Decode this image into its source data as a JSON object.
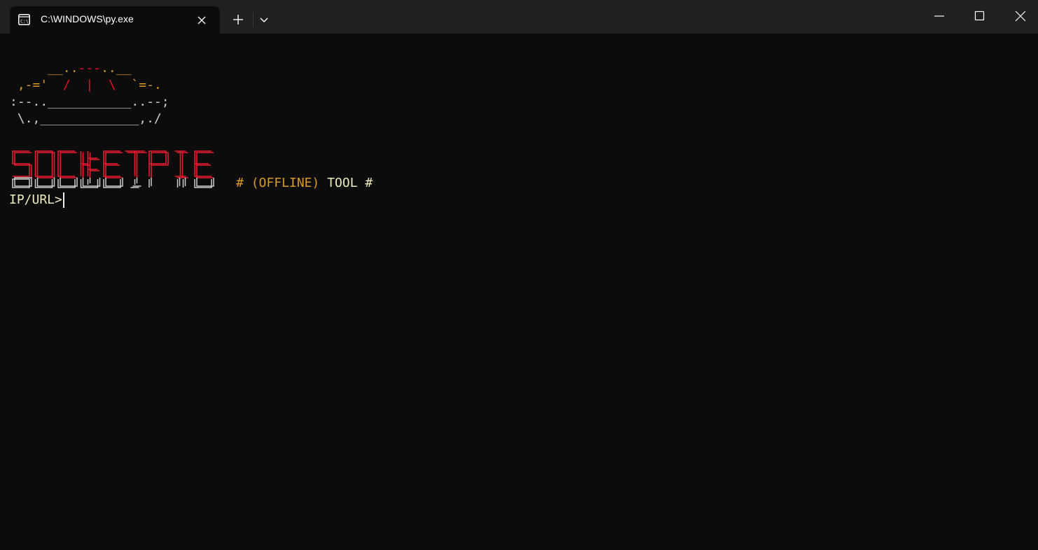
{
  "window": {
    "tab_title": "C:\\WINDOWS\\py.exe",
    "tab_icon": "terminal-icon",
    "controls": [
      "minimize-icon",
      "maximize-icon",
      "close-icon"
    ]
  },
  "terminal": {
    "pie_art": [
      [
        {
          "text": "     __..",
          "color": "orange"
        },
        {
          "text": "---",
          "color": "red"
        },
        {
          "text": "..__",
          "color": "orange"
        }
      ],
      [
        {
          "text": " ,-='  ",
          "color": "orange"
        },
        {
          "text": "/  |  \\",
          "color": "red"
        },
        {
          "text": "  `=-.",
          "color": "orange"
        }
      ],
      [
        {
          "text": ":--..___________..--;",
          "color": "white"
        }
      ],
      [
        {
          "text": " \\.,_____________,./",
          "color": "white"
        }
      ]
    ],
    "logo_text": "SOCKETPIE",
    "tagline_hash_open": "# ",
    "tagline_offline": "(OFFLINE) ",
    "tagline_tool": "TOOL #",
    "prompt": "IP/URL>"
  },
  "colors": {
    "terminal_bg": "#0c0c0c",
    "titlebar_bg": "#202020",
    "orange": "#d99a1f",
    "red": "#e81123",
    "logo_red": "#e81c2f",
    "white": "#cccccc",
    "prompt": "#f0ecc0"
  }
}
